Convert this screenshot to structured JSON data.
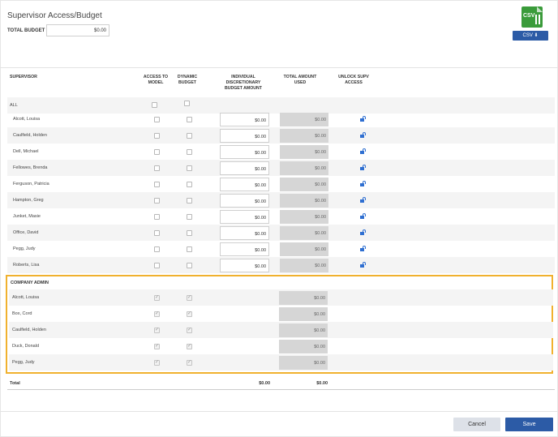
{
  "header": {
    "title": "Supervisor Access/Budget",
    "total_budget_label": "TOTAL BUDGET",
    "total_budget_value": "$0.00",
    "csv_icon_text": "CSV",
    "csv_button_label": "CSV ⬇"
  },
  "columns": {
    "supervisor": "SUPERVISOR",
    "access_to_model": "ACCESS TO MODEL",
    "dynamic_budget": "DYNAMIC BUDGET",
    "individual_budget": "INDIVIDUAL DISCRETIONARY BUDGET AMOUNT",
    "total_used": "TOTAL AMOUNT USED",
    "unlock_access": "UNLOCK SUPV ACCESS"
  },
  "all_row_label": "ALL",
  "supervisors": [
    {
      "name": "Alcott, Louisa",
      "amount": "$0.00",
      "used": "$0.00"
    },
    {
      "name": "Caulfield, Holden",
      "amount": "$0.00",
      "used": "$0.00"
    },
    {
      "name": "Dell, Michael",
      "amount": "$0.00",
      "used": "$0.00"
    },
    {
      "name": "Fellowes, Brenda",
      "amount": "$0.00",
      "used": "$0.00"
    },
    {
      "name": "Ferguson, Patricia",
      "amount": "$0.00",
      "used": "$0.00"
    },
    {
      "name": "Hampton, Greg",
      "amount": "$0.00",
      "used": "$0.00"
    },
    {
      "name": "Junket, Masie",
      "amount": "$0.00",
      "used": "$0.00"
    },
    {
      "name": "Office, David",
      "amount": "$0.00",
      "used": "$0.00"
    },
    {
      "name": "Pegg, Judy",
      "amount": "$0.00",
      "used": "$0.00"
    },
    {
      "name": "Roberts, Lisa",
      "amount": "$0.00",
      "used": "$0.00"
    }
  ],
  "company_admin": {
    "title": "COMPANY ADMIN",
    "rows": [
      {
        "name": "Alcott, Louisa",
        "used": "$0.00"
      },
      {
        "name": "Box, Cord",
        "used": "$0.00"
      },
      {
        "name": "Caulfield, Holden",
        "used": "$0.00"
      },
      {
        "name": "Duck, Donald",
        "used": "$0.00"
      },
      {
        "name": "Pegg, Judy",
        "used": "$0.00"
      }
    ]
  },
  "totals": {
    "label": "Total",
    "individual": "$0.00",
    "used": "$0.00"
  },
  "footer": {
    "cancel_label": "Cancel",
    "save_label": "Save"
  },
  "colors": {
    "primary": "#2c5ba6",
    "highlight_border": "#f0b12e",
    "csv_green": "#3a9b3a",
    "lock_blue": "#2f6fd1"
  }
}
